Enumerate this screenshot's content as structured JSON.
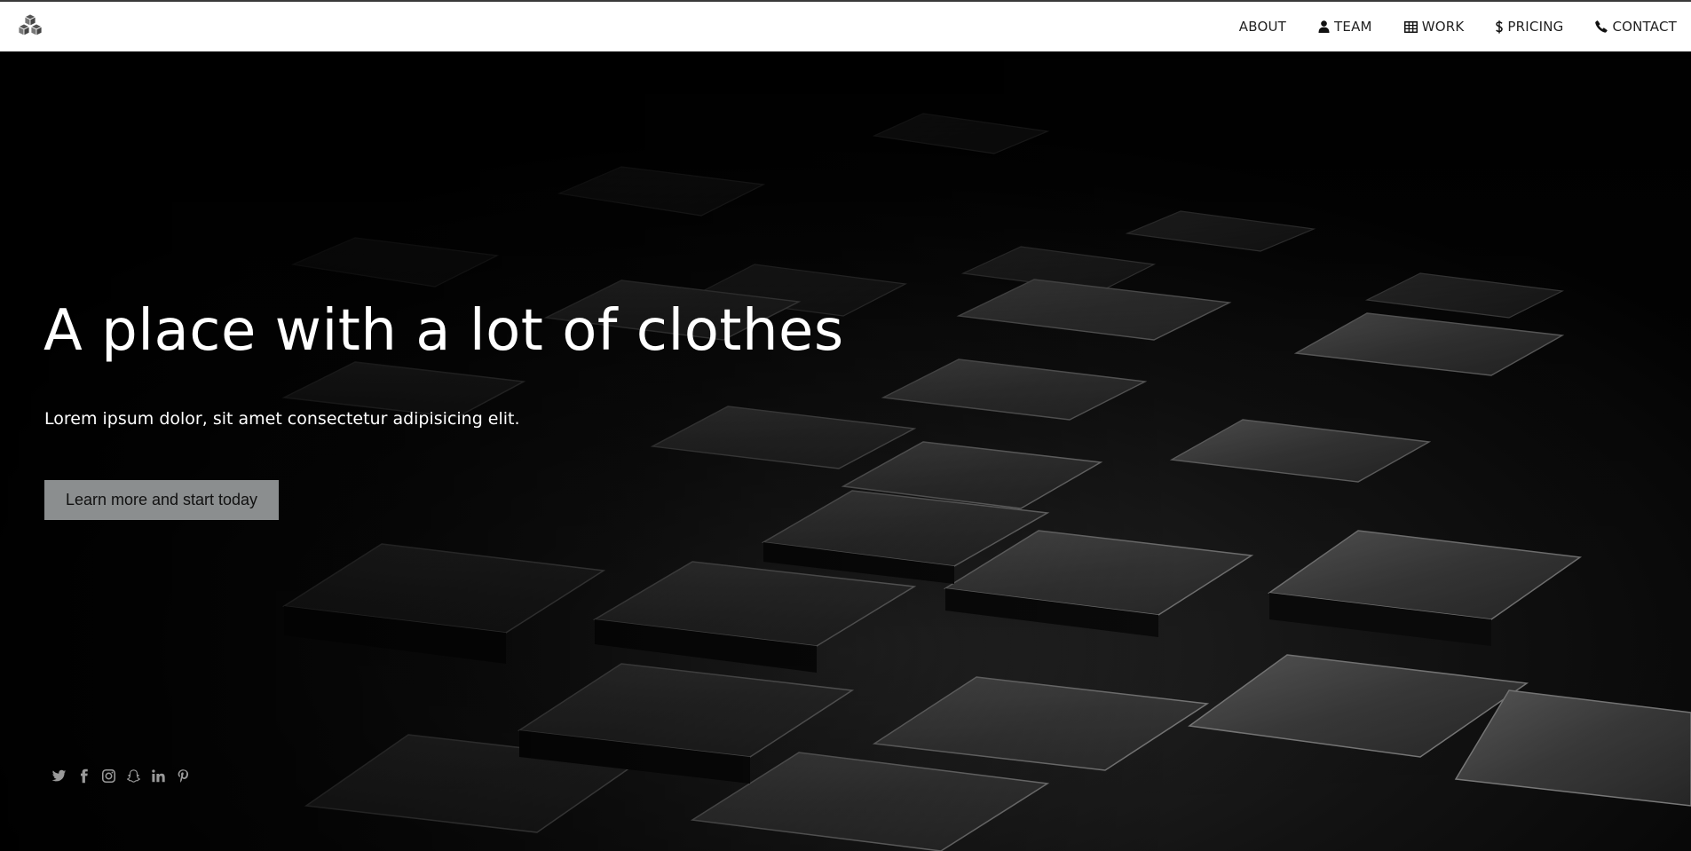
{
  "nav": {
    "logo": "cubes-logo-icon",
    "items": [
      {
        "label": "ABOUT",
        "icon": ""
      },
      {
        "label": "TEAM",
        "icon": "user-icon"
      },
      {
        "label": "WORK",
        "icon": "table-icon"
      },
      {
        "label": "PRICING",
        "icon": "dollar-icon"
      },
      {
        "label": "CONTACT",
        "icon": "phone-icon"
      }
    ]
  },
  "hero": {
    "title": "A place with a lot of clothes",
    "subtitle": "Lorem ipsum dolor, sit amet consectetur adipisicing elit.",
    "cta_label": "Learn more and start today",
    "cta_color": "#8b8e8f",
    "socials": [
      "twitter-icon",
      "facebook-icon",
      "instagram-icon",
      "snapchat-icon",
      "linkedin-icon",
      "pinterest-icon"
    ]
  },
  "colors": {
    "nav_bg": "#ffffff",
    "hero_bg": "#050505",
    "text_light": "#ffffff",
    "social_icon": "#9a9a9a"
  }
}
